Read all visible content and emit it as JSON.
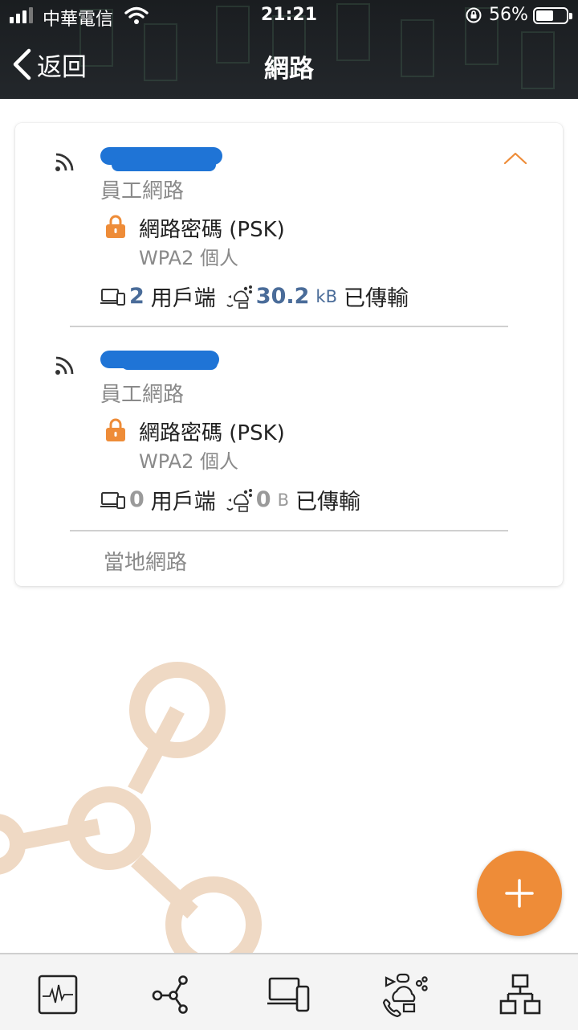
{
  "status_bar": {
    "carrier": "中華電信",
    "time": "21:21",
    "battery": "56%"
  },
  "header": {
    "back_label": "返回",
    "title": "網路"
  },
  "networks": [
    {
      "role": "員工網路",
      "security": "網路密碼 (PSK)",
      "security_type": "WPA2 個人",
      "clients_count": "2",
      "clients_label": "用戶端",
      "transfer_value": "30.2",
      "transfer_unit": "kB",
      "transfer_label": "已傳輸"
    },
    {
      "role": "員工網路",
      "security": "網路密碼 (PSK)",
      "security_type": "WPA2 個人",
      "clients_count": "0",
      "clients_label": "用戶端",
      "transfer_value": "0",
      "transfer_unit": "B",
      "transfer_label": "已傳輸"
    }
  ],
  "local_network_label": "當地網路",
  "colors": {
    "accent": "#ee8c38",
    "value_blue": "#4a6c99",
    "redaction_blue": "#1f74d6",
    "header_dark": "#1f2327"
  },
  "icons": {
    "fab": "plus-icon",
    "tabs": [
      "activity-icon",
      "topology-icon",
      "devices-icon",
      "apps-icon",
      "network-tree-icon"
    ]
  }
}
